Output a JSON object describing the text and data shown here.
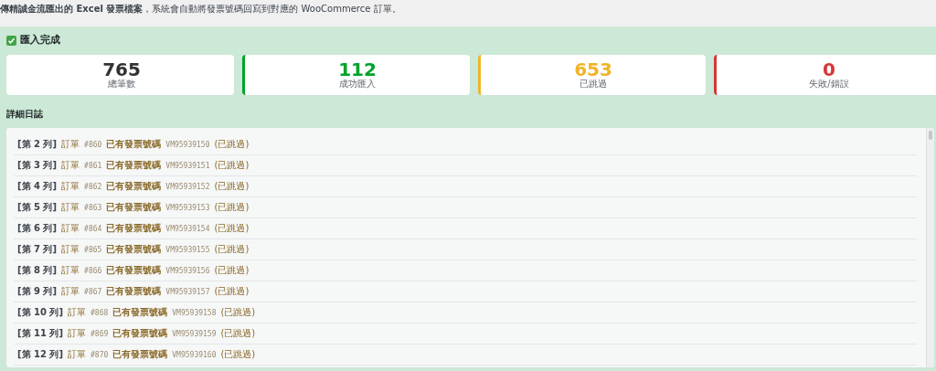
{
  "intro": "**傳精誠金流匯出的 Excel 發票檔案**，系統會自動將發票號碼回寫到對應的 WooCommerce 訂單。",
  "result": {
    "title": "匯入完成",
    "done": true
  },
  "stats": [
    {
      "value": "765",
      "label": "總筆數",
      "kind": "plain",
      "color": "#333333"
    },
    {
      "value": "112",
      "label": "成功匯入",
      "kind": "accent",
      "color": "#00a32a"
    },
    {
      "value": "653",
      "label": "已跳過",
      "kind": "accent",
      "color": "#f0b429"
    },
    {
      "value": "0",
      "label": "失敗/錯誤",
      "kind": "accent",
      "color": "#d63638"
    }
  ],
  "log": {
    "title": "詳細日誌",
    "rows": [
      {
        "row": "[第 2 列]",
        "order_label": "訂單",
        "order_no": "#860",
        "status": "已有發票號碼",
        "invoice": "VM95939150",
        "note": "(已跳過)"
      },
      {
        "row": "[第 3 列]",
        "order_label": "訂單",
        "order_no": "#861",
        "status": "已有發票號碼",
        "invoice": "VM95939151",
        "note": "(已跳過)"
      },
      {
        "row": "[第 4 列]",
        "order_label": "訂單",
        "order_no": "#862",
        "status": "已有發票號碼",
        "invoice": "VM95939152",
        "note": "(已跳過)"
      },
      {
        "row": "[第 5 列]",
        "order_label": "訂單",
        "order_no": "#863",
        "status": "已有發票號碼",
        "invoice": "VM95939153",
        "note": "(已跳過)"
      },
      {
        "row": "[第 6 列]",
        "order_label": "訂單",
        "order_no": "#864",
        "status": "已有發票號碼",
        "invoice": "VM95939154",
        "note": "(已跳過)"
      },
      {
        "row": "[第 7 列]",
        "order_label": "訂單",
        "order_no": "#865",
        "status": "已有發票號碼",
        "invoice": "VM95939155",
        "note": "(已跳過)"
      },
      {
        "row": "[第 8 列]",
        "order_label": "訂單",
        "order_no": "#866",
        "status": "已有發票號碼",
        "invoice": "VM95939156",
        "note": "(已跳過)"
      },
      {
        "row": "[第 9 列]",
        "order_label": "訂單",
        "order_no": "#867",
        "status": "已有發票號碼",
        "invoice": "VM95939157",
        "note": "(已跳過)"
      },
      {
        "row": "[第 10 列]",
        "order_label": "訂單",
        "order_no": "#868",
        "status": "已有發票號碼",
        "invoice": "VM95939158",
        "note": "(已跳過)"
      },
      {
        "row": "[第 11 列]",
        "order_label": "訂單",
        "order_no": "#869",
        "status": "已有發票號碼",
        "invoice": "VM95939159",
        "note": "(已跳過)"
      },
      {
        "row": "[第 12 列]",
        "order_label": "訂單",
        "order_no": "#870",
        "status": "已有發票號碼",
        "invoice": "VM95939160",
        "note": "(已跳過)"
      }
    ]
  }
}
